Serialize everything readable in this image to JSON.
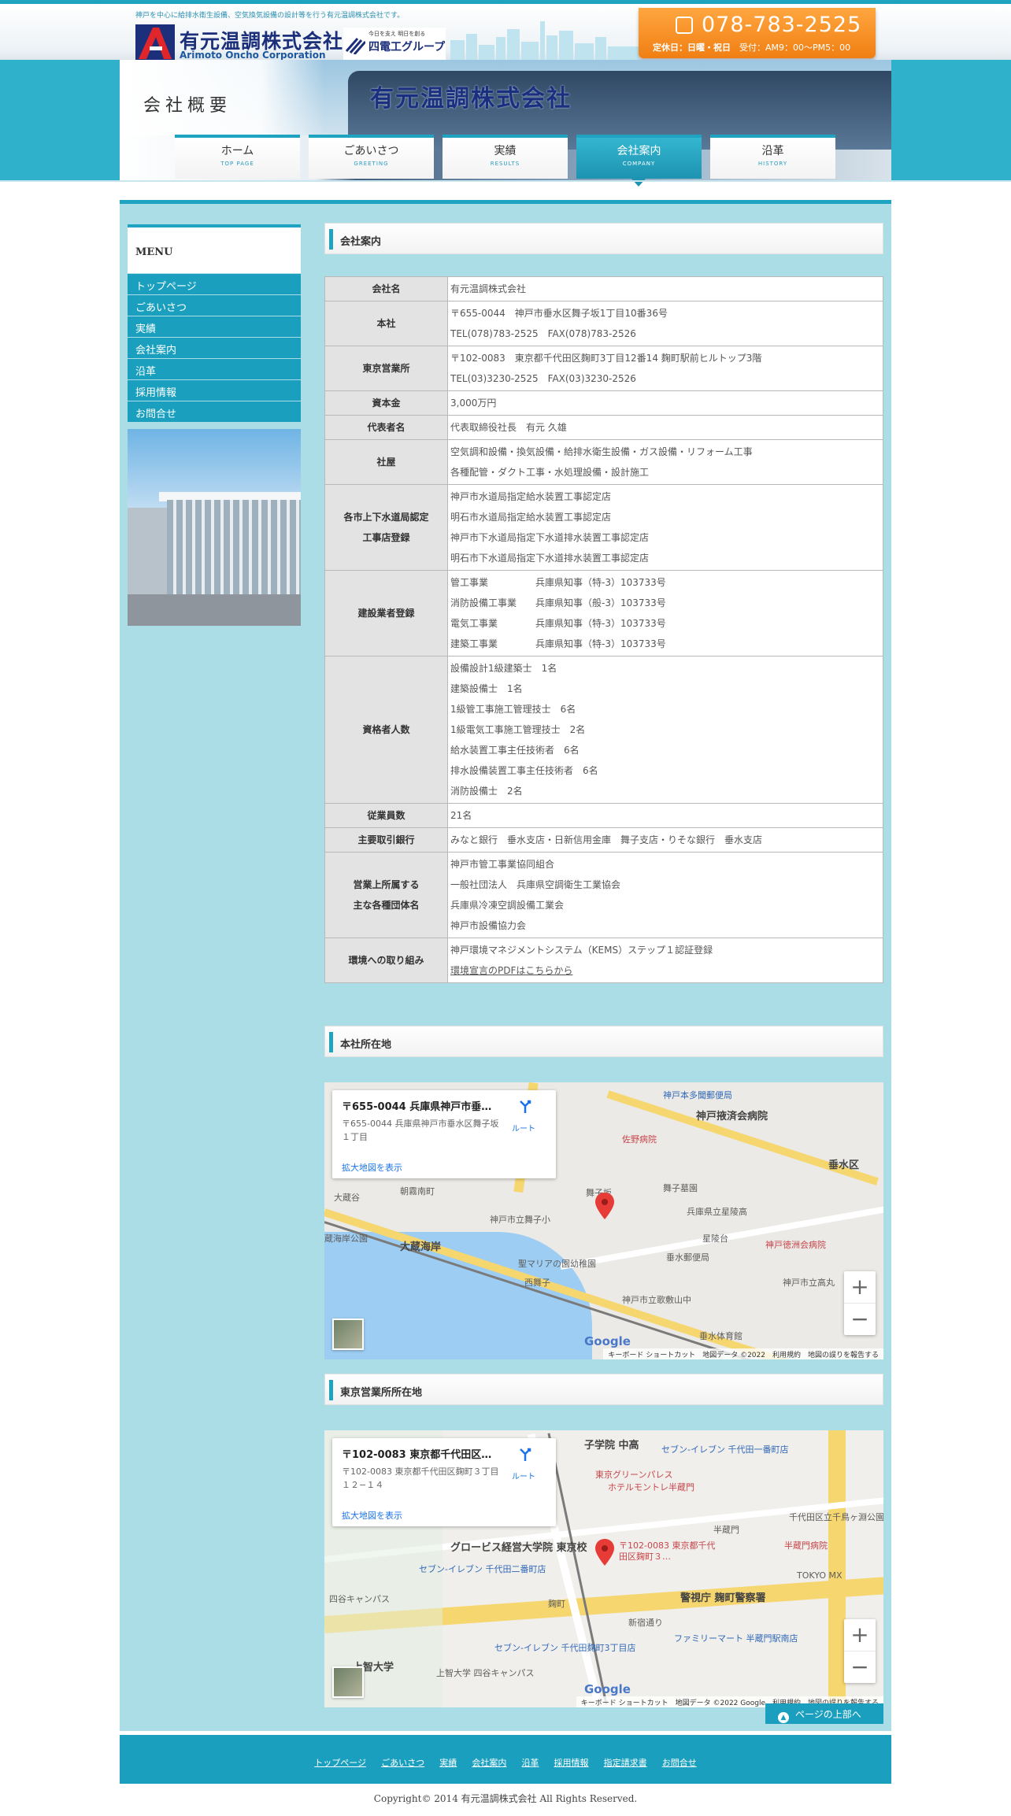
{
  "header": {
    "tagline": "神戸を中心に給排水衛生設備、空気換気設備の設計等を行う有元温調株式会社です。",
    "logo_jp": "有元温調株式会社",
    "logo_en": "Arimoto Oncho Corporation",
    "group_small": "今日を支え 明日を創る",
    "group_name": "四電工グループ",
    "phone": "078-783-2525",
    "hours_holiday": "定休日：日曜・祝日",
    "hours_time": "受付：AM9：00〜PM5：00"
  },
  "hero": {
    "sign": "会社概要",
    "building_name": "有元温調株式会社"
  },
  "nav": [
    {
      "jp": "ホーム",
      "en": "TOP PAGE"
    },
    {
      "jp": "ごあいさつ",
      "en": "GREETING"
    },
    {
      "jp": "実績",
      "en": "RESULTS"
    },
    {
      "jp": "会社案内",
      "en": "COMPANY"
    },
    {
      "jp": "沿革",
      "en": "HISTORY"
    }
  ],
  "sidebar": {
    "menu_title": "MENU",
    "items": [
      "トップページ",
      "ごあいさつ",
      "実績",
      "会社案内",
      "沿革",
      "採用情報",
      "お問合せ"
    ]
  },
  "company": {
    "title": "会社案内",
    "rows": [
      {
        "key": [
          "会社名"
        ],
        "values": [
          "有元温調株式会社"
        ]
      },
      {
        "key": [
          "本社"
        ],
        "values": [
          "〒655-0044　神戸市垂水区舞子坂1丁目10番36号",
          "TEL(078)783-2525　FAX(078)783-2526"
        ]
      },
      {
        "key": [
          "東京営業所"
        ],
        "values": [
          "〒102-0083　東京都千代田区麹町3丁目12番14 麹町駅前ヒルトップ3階",
          "TEL(03)3230-2525　FAX(03)3230-2526"
        ]
      },
      {
        "key": [
          "資本金"
        ],
        "values": [
          "3,000万円"
        ]
      },
      {
        "key": [
          "代表者名"
        ],
        "values": [
          "代表取締役社長　有元 久雄"
        ]
      },
      {
        "key": [
          "社屋"
        ],
        "values": [
          "空気調和設備・換気設備・給排水衛生設備・ガス設備・リフォーム工事",
          "各種配管・ダクト工事・水処理設備・設計施工"
        ]
      },
      {
        "key": [
          "各市上下水道局認定",
          "工事店登録"
        ],
        "values": [
          "神戸市水道局指定給水装置工事認定店",
          "明石市水道局指定給水装置工事認定店",
          "神戸市下水道局指定下水道排水装置工事認定店",
          "明石市下水道局指定下水道排水装置工事認定店"
        ]
      },
      {
        "key": [
          "建設業者登録"
        ],
        "values": [
          "管工事業　　　　　兵庫県知事（特-3）103733号",
          "消防設備工事業　　兵庫県知事（般-3）103733号",
          "電気工事業　　　　兵庫県知事（特-3）103733号",
          "建築工事業　　　　兵庫県知事（特-3）103733号"
        ]
      },
      {
        "key": [
          "資格者人数"
        ],
        "values": [
          "設備設計1級建築士　1名",
          "建築設備士　1名",
          "1級管工事施工管理技士　6名",
          "1級電気工事施工管理技士　2名",
          "給水装置工事主任技術者　6名",
          "排水設備装置工事主任技術者　6名",
          "消防設備士　2名"
        ]
      },
      {
        "key": [
          "従業員数"
        ],
        "values": [
          "21名"
        ]
      },
      {
        "key": [
          "主要取引銀行"
        ],
        "values": [
          "みなと銀行　垂水支店・日新信用金庫　舞子支店・りそな銀行　垂水支店"
        ]
      },
      {
        "key": [
          "営業上所属する",
          "主な各種団体名"
        ],
        "values": [
          "神戸市管工事業協同組合",
          "一般社団法人　兵庫県空調衛生工業協会",
          "兵庫県冷凍空調設備工業会",
          "神戸市設備協力会"
        ]
      },
      {
        "key": [
          "環境への取り組み"
        ],
        "values": [
          "神戸環境マネジメントシステム（KEMS）ステップ１認証登録"
        ],
        "link": "環境宣言のPDFはこちらから"
      }
    ]
  },
  "map_head": {
    "title": "本社所在地",
    "card_title": "〒655-0044 兵庫県神戸市垂水区舞子坂１丁目",
    "card_addr": "〒655-0044 兵庫県神戸市垂水区舞子坂１丁目",
    "route": "ルート",
    "larger": "拡大地図を表示",
    "labels": [
      "神戸本多聞郵便局",
      "神戸掖済会病院",
      "佐野病院",
      "垂水区",
      "舞子墓園",
      "大蔵谷",
      "朝霧南町",
      "神戸市立舞子小",
      "兵庫県立星陵高",
      "蔵海岸公園",
      "大蔵海岸",
      "星陵台",
      "神戸徳洲会病院",
      "垂水郵便局",
      "聖マリアの園幼稚園",
      "西舞子",
      "神戸市立歌敷山中",
      "舞子坂",
      "垂水体育館",
      "神戸市立高丸"
    ],
    "attribution": "キーボード ショートカット　地図データ ©2022　利用規約　地図の誤りを報告する"
  },
  "map_tokyo": {
    "title": "東京営業所所在地",
    "card_title": "〒102-0083 東京都千代田区麹町３丁目１２−１４",
    "card_addr": "〒102-0083 東京都千代田区麹町３丁目１２−１４",
    "route": "ルート",
    "larger": "拡大地図を表示",
    "pin_label": "〒102-0083 東京都千代田区麹町３…",
    "labels": [
      "子学院 中高",
      "セブン-イレブン 千代田一番町店",
      "東京グリーンパレス",
      "ホテルモントレ半蔵門",
      "半蔵門",
      "半蔵門病院",
      "グロービス経営大学院 東京校",
      "セブン-イレブン 千代田二番町店",
      "麹町",
      "警視庁 麹町警察署",
      "新宿通り",
      "四谷キャンパス",
      "ファミリーマート 半蔵門駅南店",
      "セブン-イレブン 千代田麹町3丁目店",
      "上智大学",
      "上智大学 四谷キャンパス",
      "TOKYO MX",
      "千代田区立千鳥ヶ淵公園"
    ],
    "attribution": "キーボード ショートカット　地図データ ©2022 Google　利用規約　地図の誤りを報告する"
  },
  "pagetop": "ページの上部へ",
  "footnav": [
    "トップページ",
    "ごあいさつ",
    "実績",
    "会社案内",
    "沿革",
    "採用情報",
    "指定請求書",
    "お問合せ"
  ],
  "copyright": "Copyright© 2014 有元温調株式会社 All Rights Reserved.",
  "colors": {
    "accent": "#1ea4c0",
    "main_bg": "#abdde6",
    "phone_bg": "#f07f13",
    "logo_blue": "#1b2f7a"
  }
}
